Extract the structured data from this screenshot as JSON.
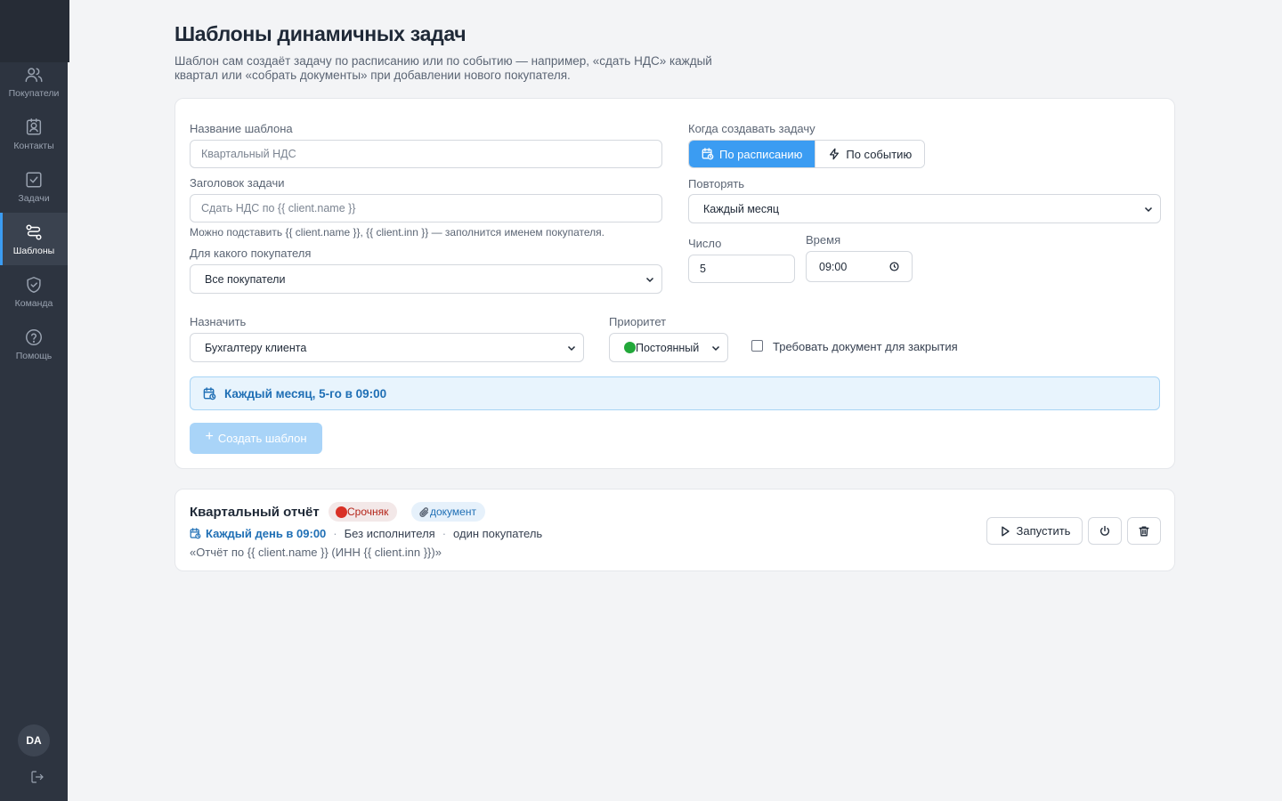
{
  "sidebar": {
    "items": [
      {
        "label": "Покупатели",
        "icon": "users-icon"
      },
      {
        "label": "Контакты",
        "icon": "contact-card-icon"
      },
      {
        "label": "Задачи",
        "icon": "checkbox-icon"
      },
      {
        "label": "Шаблоны",
        "icon": "templates-icon",
        "active": true
      },
      {
        "label": "Команда",
        "icon": "shield-icon"
      },
      {
        "label": "Помощь",
        "icon": "help-icon"
      }
    ],
    "avatar_initials": "DA",
    "logout_icon": "logout-icon"
  },
  "header": {
    "title": "Шаблоны динамичных задач",
    "description": "Шаблон сам создаёт задачу по расписанию или по событию — например, «сдать НДС» каждый квартал или «собрать документы» при добавлении нового покупателя."
  },
  "form": {
    "template_name": {
      "label": "Название шаблона",
      "placeholder": "Квартальный НДС",
      "value": ""
    },
    "task_title": {
      "label": "Заголовок задачи",
      "placeholder": "Сдать НДС по {{ client.name }}",
      "value": ""
    },
    "task_title_hint": "Можно подставить {{ client.name }}, {{ client.inn }} — заполнится именем покупателя.",
    "client": {
      "label": "Для какого покупателя",
      "value": "Все покупатели"
    },
    "trigger": {
      "label": "Когда создавать задачу",
      "options": [
        "По расписанию",
        "По событию"
      ],
      "selected": "По расписанию"
    },
    "repeat": {
      "label": "Повторять",
      "value": "Каждый месяц"
    },
    "day": {
      "label": "Число",
      "value": "5"
    },
    "time": {
      "label": "Время",
      "value": "09:00"
    },
    "assignee": {
      "label": "Назначить",
      "value": "Бухгалтеру клиента"
    },
    "priority": {
      "label": "Приоритет",
      "value": "Постоянный",
      "color": "#22a83a"
    },
    "require_document": {
      "label": "Требовать документ для закрытия",
      "checked": false
    },
    "summary": "Каждый месяц, 5-го в 09:00",
    "create_button": "Создать шаблон"
  },
  "templates": [
    {
      "title": "Квартальный отчёт",
      "priority_badge": "Срочняк",
      "priority_color": "#d93025",
      "doc_badge": "документ",
      "schedule": "Каждый день в 09:00",
      "assignee": "Без исполнителя",
      "scope": "один покупатель",
      "preview": "«Отчёт по {{ client.name }} (ИНН {{ client.inn }})»",
      "run_label": "Запустить"
    }
  ],
  "colors": {
    "accent": "#3b9cf2",
    "sidebar_bg": "#2d3440",
    "page_bg": "#f3f4f6"
  }
}
